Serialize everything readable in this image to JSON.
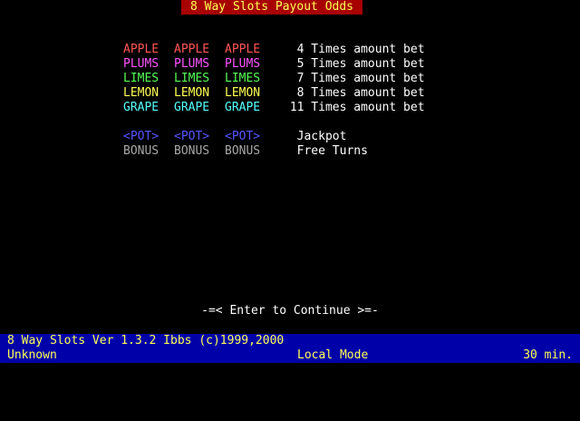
{
  "title": "8 Way Slots Payout Odds",
  "odds": [
    {
      "symbols": [
        "APPLE",
        "APPLE",
        "APPLE"
      ],
      "payout": "  4 Times amount bet",
      "color": "#ff5555"
    },
    {
      "symbols": [
        "PLUMS",
        "PLUMS",
        "PLUMS"
      ],
      "payout": "  5 Times amount bet",
      "color": "#ff55ff"
    },
    {
      "symbols": [
        "LIMES",
        "LIMES",
        "LIMES"
      ],
      "payout": "  7 Times amount bet",
      "color": "#55ff55"
    },
    {
      "symbols": [
        "LEMON",
        "LEMON",
        "LEMON"
      ],
      "payout": "  8 Times amount bet",
      "color": "#ffff55"
    },
    {
      "symbols": [
        "GRAPE",
        "GRAPE",
        "GRAPE"
      ],
      "payout": " 11 Times amount bet",
      "color": "#55ffff"
    }
  ],
  "specials": [
    {
      "symbols": [
        "<POT>",
        "<POT>",
        "<POT>"
      ],
      "payout": "  Jackpot",
      "color": "#5555ff"
    },
    {
      "symbols": [
        "BONUS",
        "BONUS",
        "BONUS"
      ],
      "payout": "  Free Turns",
      "color": "#a8a8a8"
    }
  ],
  "continue_prompt": "-=< Enter to Continue >=-",
  "status": {
    "version": "8 Way Slots Ver 1.3.2 Ibbs (c)1999,2000",
    "user": "Unknown",
    "mode": "Local Mode",
    "time_left": "30 min."
  }
}
